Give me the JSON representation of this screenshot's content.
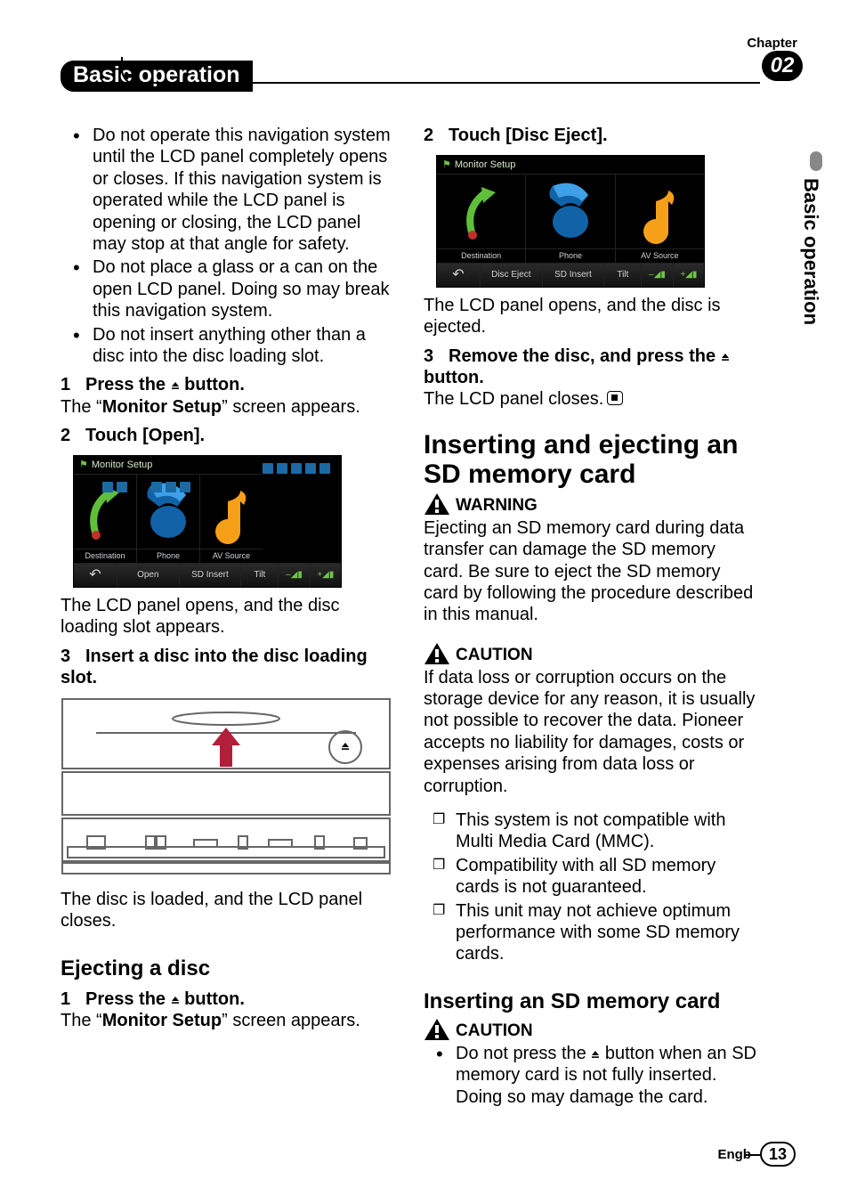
{
  "header": {
    "chapter_label": "Chapter",
    "chapter_number": "02",
    "title": "Basic operation",
    "side_label": "Basic operation"
  },
  "footer": {
    "lang": "Engb",
    "page": "13"
  },
  "left": {
    "bullets": [
      "Do not operate this navigation system until the LCD panel completely opens or closes. If this navigation system is operated while the LCD panel is opening or closing, the LCD panel may stop at that angle for safety.",
      "Do not place a glass or a can on the open LCD panel. Doing so may break this navigation system.",
      "Do not insert anything other than a disc into the disc loading slot."
    ],
    "step1_num": "1",
    "step1_pre": "Press the ",
    "step1_post": " button.",
    "step1_after_pre": "The “",
    "step1_after_bold": "Monitor Setup",
    "step1_after_post": "” screen appears.",
    "step2_num": "2",
    "step2_text": "Touch [Open].",
    "screenshot1": {
      "title": "Monitor Setup",
      "labels": [
        "Destination",
        "Phone",
        "AV Source"
      ],
      "buttons_back": "↶",
      "buttons": [
        "Open",
        "SD Insert",
        "Tilt"
      ]
    },
    "after_ss1": "The LCD panel opens, and the disc loading slot appears.",
    "step3_num": "3",
    "step3_text": "Insert a disc into the disc loading slot.",
    "after_unit": "The disc is loaded, and the LCD panel closes.",
    "h3_eject": "Ejecting a disc",
    "eject_step1_num": "1",
    "eject_step1_pre": "Press the ",
    "eject_step1_post": " button.",
    "eject_after_pre": "The “",
    "eject_after_bold": "Monitor Setup",
    "eject_after_post": "” screen appears."
  },
  "right": {
    "step2_num": "2",
    "step2_text": "Touch [Disc Eject].",
    "screenshot2": {
      "title": "Monitor Setup",
      "labels": [
        "Destination",
        "Phone",
        "AV Source"
      ],
      "buttons_back": "↶",
      "buttons": [
        "Disc Eject",
        "SD Insert",
        "Tilt"
      ]
    },
    "after_ss2": "The LCD panel opens, and the disc is ejected.",
    "step3_num": "3",
    "step3_pre": "Remove the disc, and press the ",
    "step3_post": " button.",
    "step3_after": "The LCD panel closes.",
    "h2_sd": "Inserting and ejecting an SD memory card",
    "warning_label": "WARNING",
    "warning_text": "Ejecting an SD memory card during data transfer can damage the SD memory card. Be sure to eject the SD memory card by following the procedure described in this manual.",
    "caution_label": "CAUTION",
    "caution_text": "If data loss or corruption occurs on the storage device for any reason, it is usually not possible to recover the data. Pioneer accepts no liability for damages, costs or expenses arising from data loss or corruption.",
    "notes": [
      "This system is not compatible with Multi Media Card (MMC).",
      "Compatibility with all SD memory cards is not guaranteed.",
      "This unit may not achieve optimum performance with some SD memory cards."
    ],
    "h3_insert": "Inserting an SD memory card",
    "caution2_label": "CAUTION",
    "caution2_pre": "Do not press the ",
    "caution2_post": " button when an SD memory card is not fully inserted. Doing so may damage the card."
  }
}
